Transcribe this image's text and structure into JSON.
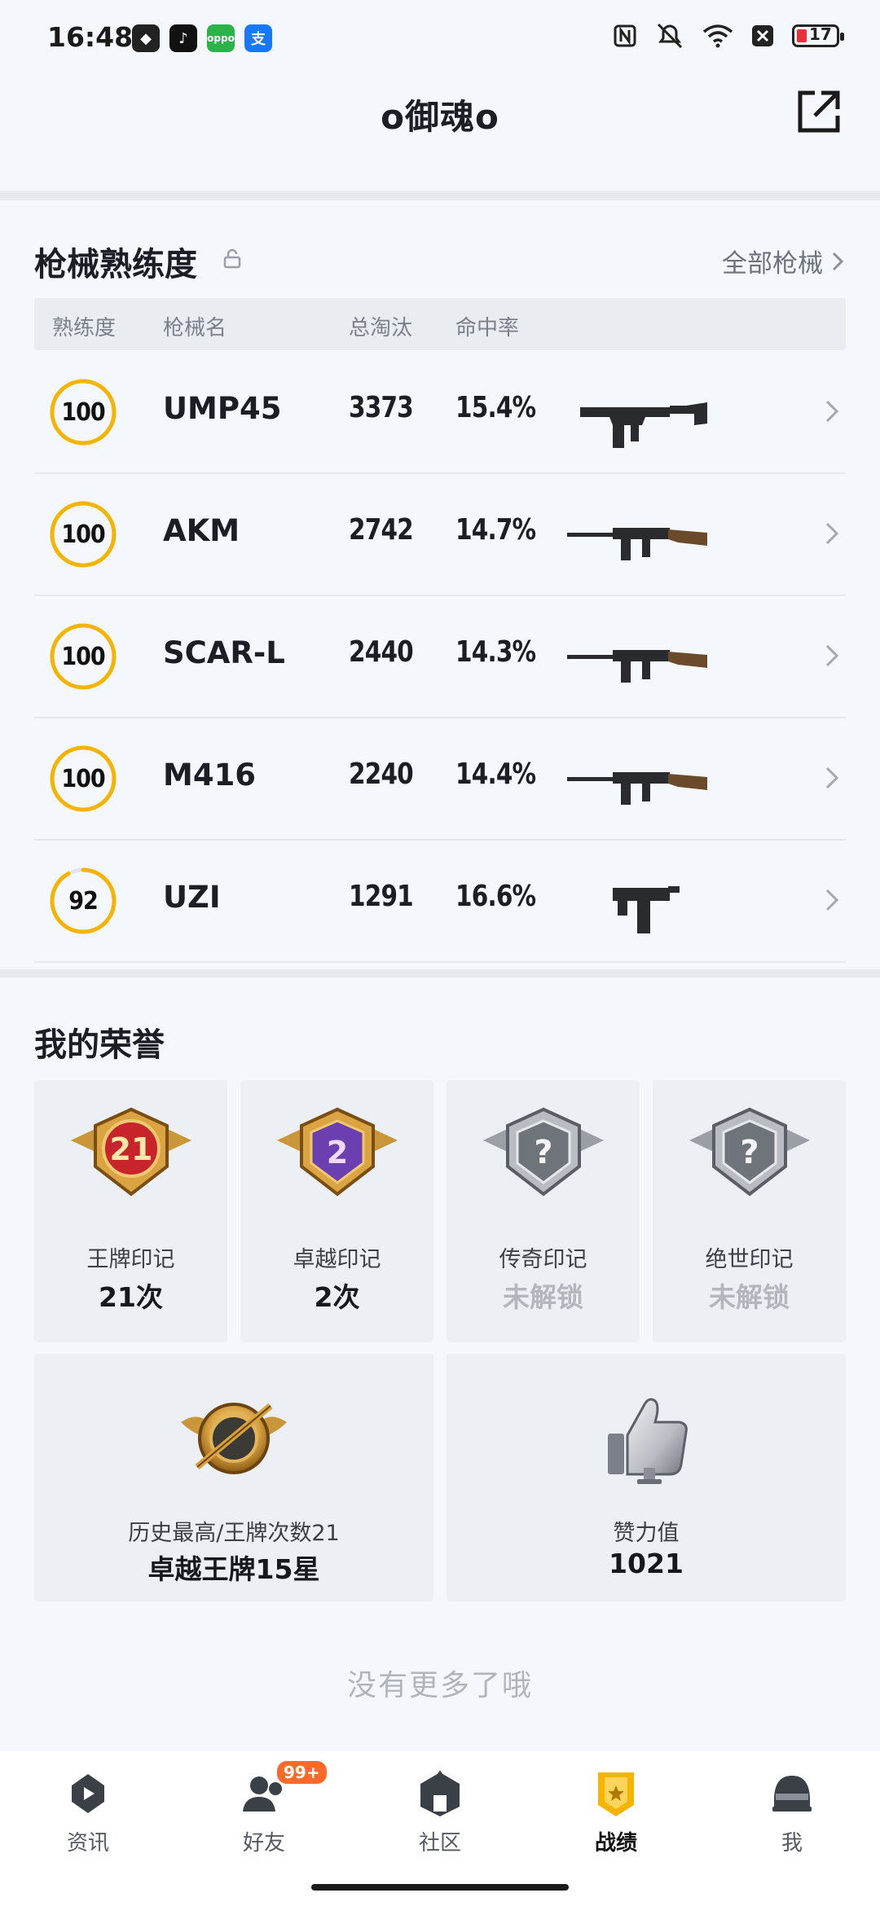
{
  "status_bar": {
    "time": "16:48",
    "battery": "17"
  },
  "header": {
    "title": "o御魂o"
  },
  "weapon_section": {
    "title": "枪械熟练度",
    "all_link": "全部枪械",
    "columns": [
      "熟练度",
      "枪械名",
      "总淘汰",
      "命中率"
    ],
    "rows": [
      {
        "proficiency": "100",
        "progress": 1.0,
        "name": "UMP45",
        "kills": "3373",
        "accuracy": "15.4%",
        "gun_icon": "smg-icon"
      },
      {
        "proficiency": "100",
        "progress": 1.0,
        "name": "AKM",
        "kills": "2742",
        "accuracy": "14.7%",
        "gun_icon": "rifle-icon"
      },
      {
        "proficiency": "100",
        "progress": 1.0,
        "name": "SCAR-L",
        "kills": "2440",
        "accuracy": "14.3%",
        "gun_icon": "rifle-icon"
      },
      {
        "proficiency": "100",
        "progress": 1.0,
        "name": "M416",
        "kills": "2240",
        "accuracy": "14.4%",
        "gun_icon": "rifle-icon"
      },
      {
        "proficiency": "92",
        "progress": 0.92,
        "name": "UZI",
        "kills": "1291",
        "accuracy": "16.6%",
        "gun_icon": "pistol-smg-icon"
      }
    ]
  },
  "honor_section": {
    "title": "我的荣誉",
    "marks": [
      {
        "name": "王牌印记",
        "value": "21次",
        "medal_text": "21",
        "locked": false
      },
      {
        "name": "卓越印记",
        "value": "2次",
        "medal_text": "2",
        "locked": false
      },
      {
        "name": "传奇印记",
        "value": "未解锁",
        "medal_text": "?",
        "locked": true
      },
      {
        "name": "绝世印记",
        "value": "未解锁",
        "medal_text": "?",
        "locked": true
      }
    ],
    "highest": {
      "name": "历史最高/王牌次数21",
      "value": "卓越王牌15星"
    },
    "likes": {
      "name": "赞力值",
      "value": "1021"
    }
  },
  "footer_text": "没有更多了哦",
  "bottom_nav": {
    "items": [
      {
        "label": "资讯",
        "active": false
      },
      {
        "label": "好友",
        "active": false,
        "badge": "99+"
      },
      {
        "label": "社区",
        "active": false
      },
      {
        "label": "战绩",
        "active": true
      },
      {
        "label": "我",
        "active": false
      }
    ]
  },
  "colors": {
    "accent": "#f5b400",
    "text": "#1b1e24",
    "muted": "#7b818b",
    "bg": "#f4f7fb"
  }
}
